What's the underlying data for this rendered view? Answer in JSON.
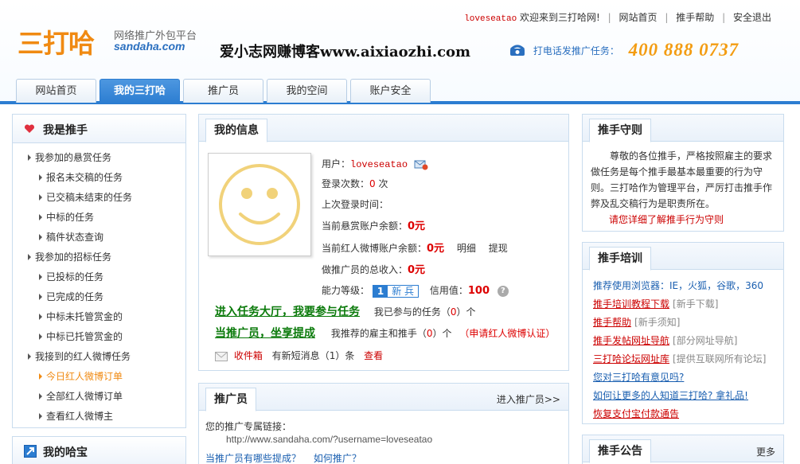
{
  "header": {
    "logo_cn": "三打哈",
    "logo_tagline": "网络推广外包平台",
    "logo_url": "sandaha.com",
    "watermark": "爱小志网赚博客www.aixiaozhi.com",
    "username": "loveseatao",
    "welcome": "欢迎来到三打哈网!",
    "links": [
      "网站首页",
      "推手帮助",
      "安全退出"
    ],
    "phone_label": "打电话发推广任务：",
    "phone_number": "400 888 0737"
  },
  "nav": {
    "tabs": [
      "网站首页",
      "我的三打哈",
      "推广员",
      "我的空间",
      "账户安全"
    ],
    "active_index": 1
  },
  "left": {
    "title": "我是推手",
    "items": [
      {
        "label": "我参加的悬赏任务",
        "level": 1
      },
      {
        "label": "报名未交稿的任务",
        "level": 2
      },
      {
        "label": "已交稿未结束的任务",
        "level": 2
      },
      {
        "label": "中标的任务",
        "level": 2
      },
      {
        "label": "稿件状态查询",
        "level": 2
      },
      {
        "label": "我参加的招标任务",
        "level": 1
      },
      {
        "label": "已投标的任务",
        "level": 2
      },
      {
        "label": "已完成的任务",
        "level": 2
      },
      {
        "label": "中标未托管赏金的",
        "level": 2
      },
      {
        "label": "中标已托管赏金的",
        "level": 2
      },
      {
        "label": "我接到的红人微博任务",
        "level": 1
      },
      {
        "label": "今日红人微博订单",
        "level": 2,
        "highlight": true
      },
      {
        "label": "全部红人微博订单",
        "level": 2
      },
      {
        "label": "查看红人微博主",
        "level": 2
      }
    ],
    "second_title": "我的哈宝"
  },
  "info": {
    "title": "我的信息",
    "user_label": "用户：",
    "user_value": "loveseatao",
    "login_count_label": "登录次数：",
    "login_count": "0",
    "login_count_unit": "次",
    "last_login_label": "上次登录时间：",
    "reward_balance_label": "当前悬赏账户余额：",
    "reward_balance": "0元",
    "weibo_balance_label": "当前红人微博账户余额：",
    "weibo_balance": "0元",
    "detail_link": "明细",
    "withdraw_link": "提现",
    "promoter_income_label": "做推广员的总收入：",
    "promoter_income": "0元",
    "level_label": "能力等级：",
    "level_num": "1",
    "level_name": "新 兵",
    "credit_label": "信用值：",
    "credit_value": "100",
    "help_icon_text": "?",
    "enter_hall": "进入任务大厅，我要参与任务",
    "my_tasks_prefix": "我已参与的任务（",
    "my_tasks_count": "0",
    "my_tasks_suffix": "）个",
    "be_promoter": "当推广员，坐享提成",
    "recommended_prefix": "我推荐的雇主和推手（",
    "recommended_count": "0",
    "recommended_suffix": "）个",
    "apply_weibo": "（申请红人微博认证）",
    "inbox_label": "收件箱",
    "new_msg_prefix": "有新短消息（",
    "new_msg_count": "1",
    "new_msg_suffix": "）条",
    "view_link": "查看"
  },
  "promoter": {
    "title": "推广员",
    "enter_link": "进入推广员>>",
    "link_label": "您的推广专属链接：",
    "link_url": "http://www.sandaha.com/?username=loveseatao",
    "q1": "当推广员有哪些提成？",
    "q2": "如何推广？"
  },
  "rules": {
    "title": "推手守则",
    "text": "尊敬的各位推手，严格按照雇主的要求做任务是每个推手最基本最重要的行为守则。三打哈作为管理平台，严厉打击推手作弊及乱交稿行为是职责所在。",
    "link": "请您详细了解推手行为守则"
  },
  "training": {
    "title": "推手培训",
    "browsers": "推荐使用浏览器：IE，火狐，谷歌，360",
    "items": [
      {
        "link": "推手培训教程下载",
        "tag": "[新手下载]",
        "style": "hl"
      },
      {
        "link": "推手帮助",
        "tag": "[新手须知]",
        "style": "hl"
      },
      {
        "link": "推手发帖网址导航",
        "tag": "[部分网址导航]",
        "style": "hl"
      },
      {
        "link": "三打哈论坛网址库",
        "tag": "[提供互联网所有论坛]",
        "style": "hl"
      },
      {
        "link": "您对三打哈有意见吗?",
        "tag": "",
        "style": "bl"
      },
      {
        "link": "如何让更多的人知道三打哈? 拿礼品!",
        "tag": "",
        "style": "bl"
      },
      {
        "link": "恢复支付宝付款通告",
        "tag": "",
        "style": "hl"
      }
    ]
  },
  "notice": {
    "title": "推手公告",
    "more": "更多"
  }
}
